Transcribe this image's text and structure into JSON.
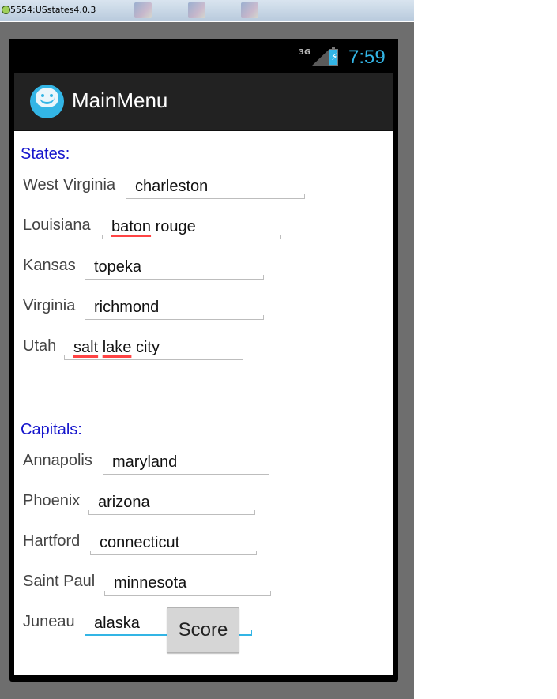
{
  "window": {
    "title": "5554:USstates4.0.3"
  },
  "status_bar": {
    "network": "3G",
    "time": "7:59",
    "accent_color": "#33b5e5"
  },
  "action_bar": {
    "title": "MainMenu"
  },
  "states_section": {
    "header": "States:",
    "rows": [
      {
        "label": "West Virginia",
        "value": "charleston"
      },
      {
        "label": "Louisiana",
        "value_parts": [
          "baton",
          " rouge"
        ]
      },
      {
        "label": "Kansas",
        "value": "topeka"
      },
      {
        "label": "Virginia",
        "value": "richmond"
      },
      {
        "label": "Utah",
        "value_parts": [
          "salt",
          " ",
          "lake",
          " city"
        ]
      }
    ]
  },
  "capitals_section": {
    "header": "Capitals:",
    "rows": [
      {
        "label": "Annapolis",
        "value": "maryland"
      },
      {
        "label": "Phoenix",
        "value": "arizona"
      },
      {
        "label": "Hartford",
        "value": "connecticut"
      },
      {
        "label": "Saint Paul",
        "value": "minnesota"
      },
      {
        "label": "Juneau",
        "value": "alaska"
      }
    ]
  },
  "score_button": {
    "label": "Score"
  }
}
